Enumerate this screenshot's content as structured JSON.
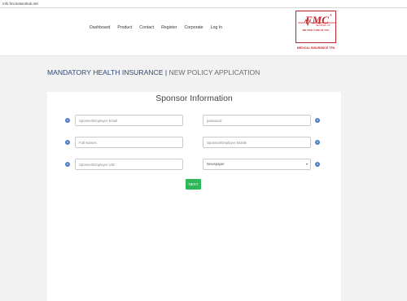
{
  "browser": {
    "url": "mhi.fmcnetworkuk.net"
  },
  "nav": {
    "items": [
      {
        "label": "Dashboard"
      },
      {
        "label": "Product"
      },
      {
        "label": "Contact"
      },
      {
        "label": "Register"
      },
      {
        "label": "Corporate"
      },
      {
        "label": "Log In"
      }
    ]
  },
  "logo": {
    "brand": "FMC",
    "registered": "®",
    "subtitle": "NETWORK UK",
    "tagline": "WE TAKE CARE OF YOU",
    "caption": "MEDICAL INSURANCE TPA",
    "color": "#c8262b"
  },
  "page": {
    "title_strong": "MANDATORY HEALTH INSURANCE",
    "title_sep": " | ",
    "title_light": "NEW POLICY APPLICATION"
  },
  "form": {
    "title": "Sponsor Information",
    "fields": {
      "sponsor_email": {
        "placeholder": "Sponsor/Employer Email"
      },
      "password": {
        "placeholder": "password"
      },
      "full_names": {
        "placeholder": "Full Names"
      },
      "sponsor_mobile": {
        "placeholder": "Sponsor/Employer Mobile"
      },
      "sponsor_uid": {
        "placeholder": "Sponsor/Employer UID"
      },
      "source": {
        "selected": "Newspaper"
      }
    },
    "info_icon": "i",
    "next_label": "NEXT"
  },
  "colors": {
    "accent_blue": "#2f4777",
    "info_blue": "#4a7fc1",
    "button_green": "#2fb85a"
  }
}
